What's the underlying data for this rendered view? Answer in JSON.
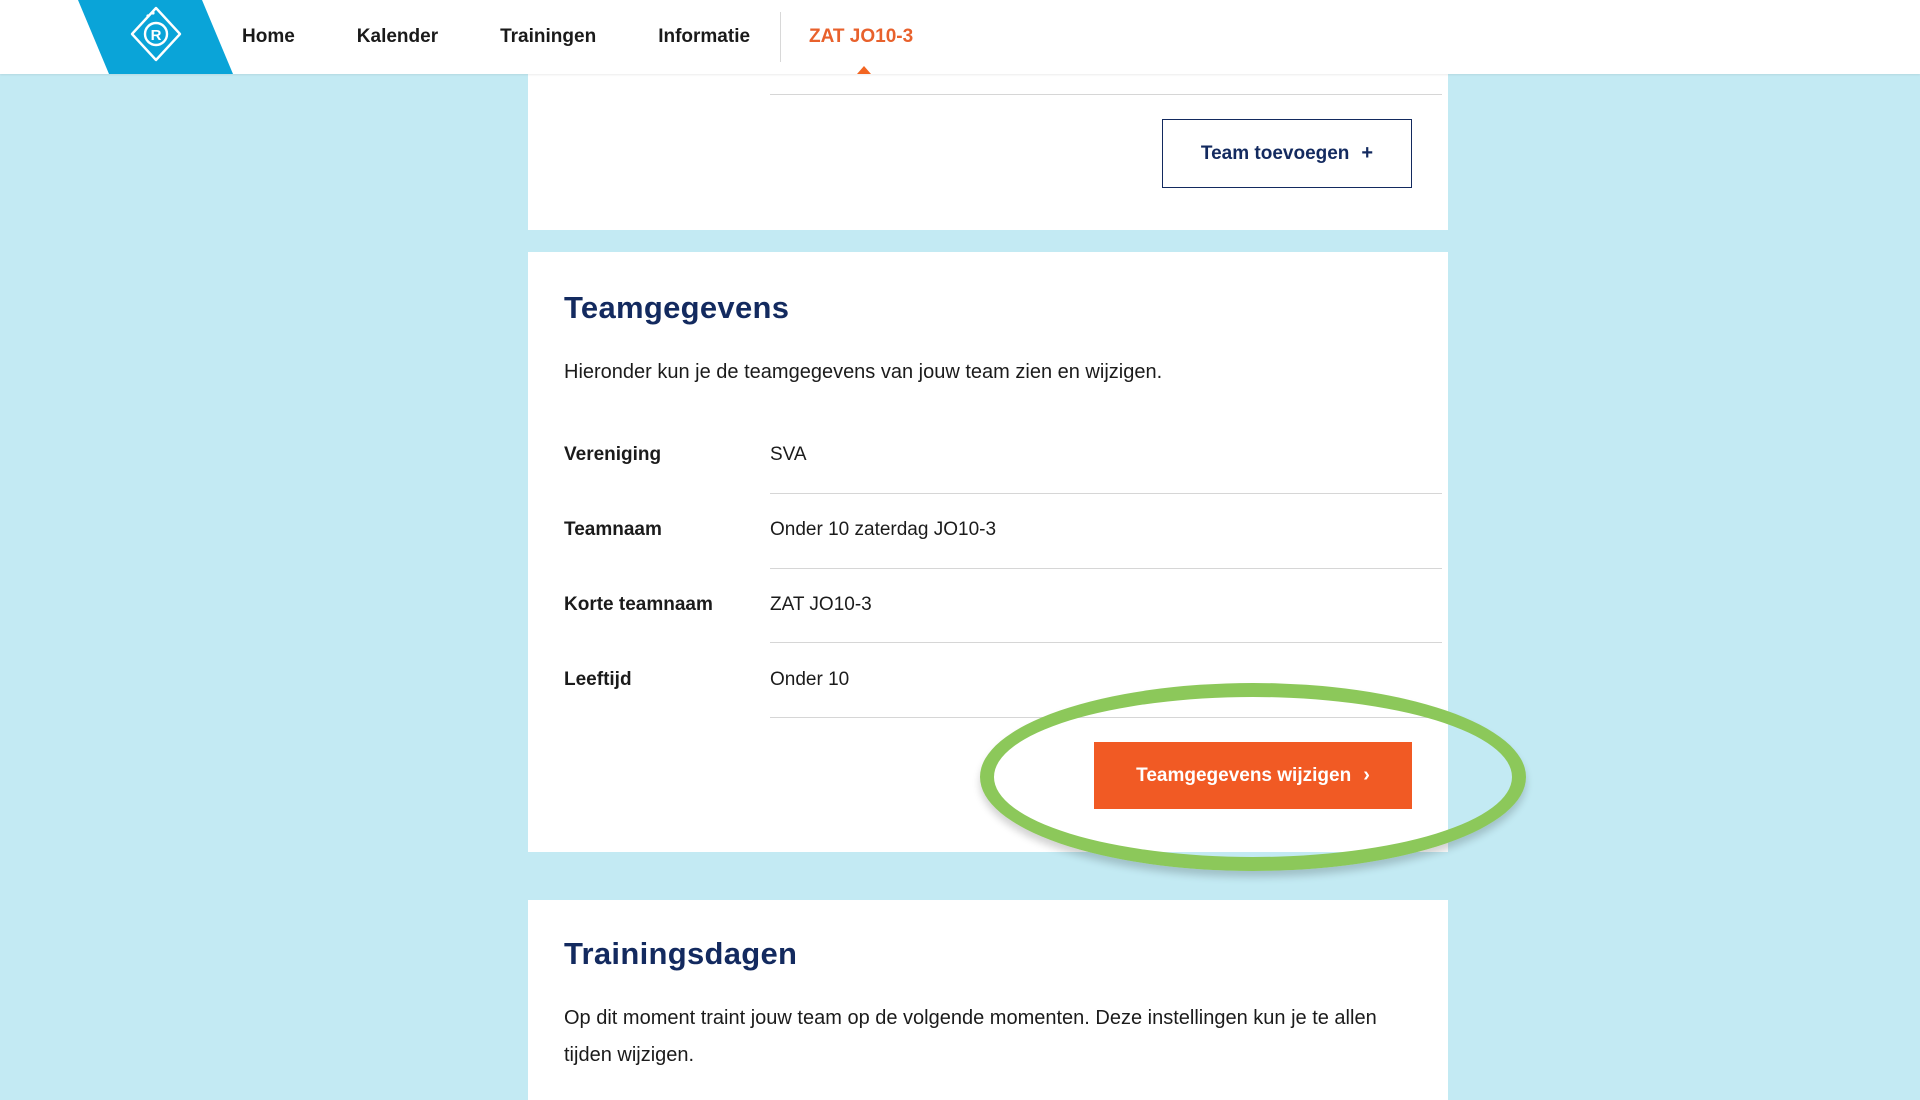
{
  "nav": {
    "items": [
      "Home",
      "Kalender",
      "Trainingen",
      "Informatie"
    ],
    "active_team": "ZAT JO10-3"
  },
  "top_card": {
    "add_team_label": "Team toevoegen",
    "add_team_icon": "+"
  },
  "teamgegevens": {
    "title": "Teamgegevens",
    "description": "Hieronder kun je de teamgegevens van jouw team zien en wijzigen.",
    "rows": [
      {
        "label": "Vereniging",
        "value": "SVA"
      },
      {
        "label": "Teamnaam",
        "value": "Onder 10 zaterdag JO10-3"
      },
      {
        "label": "Korte teamnaam",
        "value": "ZAT JO10-3"
      },
      {
        "label": "Leeftijd",
        "value": "Onder 10"
      }
    ],
    "edit_label": "Teamgegevens wijzigen",
    "edit_icon": "›"
  },
  "trainingsdagen": {
    "title": "Trainingsdagen",
    "description": "Op dit moment traint jouw team op de volgende momenten. Deze instellingen kun je te allen tijden wijzigen."
  },
  "colors": {
    "background": "#c3eaf3",
    "logo": "#0aa4d8",
    "navy": "#132a5f",
    "accent_orange": "#f15a24",
    "highlight_green": "#8cc85a"
  }
}
